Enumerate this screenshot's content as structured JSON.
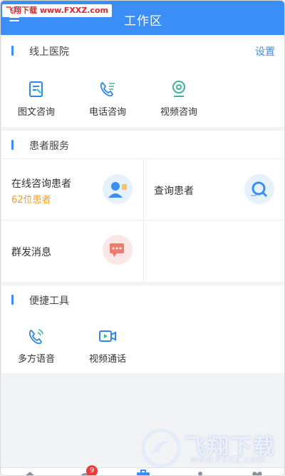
{
  "header": {
    "title": "工作区"
  },
  "watermark_top": {
    "brand": "飞翔下载",
    "url": "www.FXXZ.com"
  },
  "online_hospital": {
    "title": "线上医院",
    "settings": "设置",
    "tools": [
      {
        "label": "图文咨询",
        "icon": "document-chat-icon"
      },
      {
        "label": "电话咨询",
        "icon": "phone-icon"
      },
      {
        "label": "视频咨询",
        "icon": "webcam-icon"
      }
    ]
  },
  "patient_service": {
    "title": "患者服务",
    "cells": [
      {
        "title": "在线咨询患者",
        "subtitle": "62位患者",
        "icon": "doctor-avatar-icon"
      },
      {
        "title": "查询患者",
        "icon": "search-icon"
      },
      {
        "title": "群发消息",
        "icon": "message-icon"
      }
    ]
  },
  "shortcuts": {
    "title": "便捷工具",
    "tools": [
      {
        "label": "多方语音",
        "icon": "voice-call-icon"
      },
      {
        "label": "视频通话",
        "icon": "video-call-icon"
      }
    ]
  },
  "bottom_nav": {
    "badge_count": "9"
  },
  "watermark_bottom": {
    "brand": "飞翔下载",
    "url": "www.FXXZ.com"
  },
  "colors": {
    "accent": "#3a8ef6",
    "orange": "#f0a020",
    "badge": "#ee3b3b"
  }
}
